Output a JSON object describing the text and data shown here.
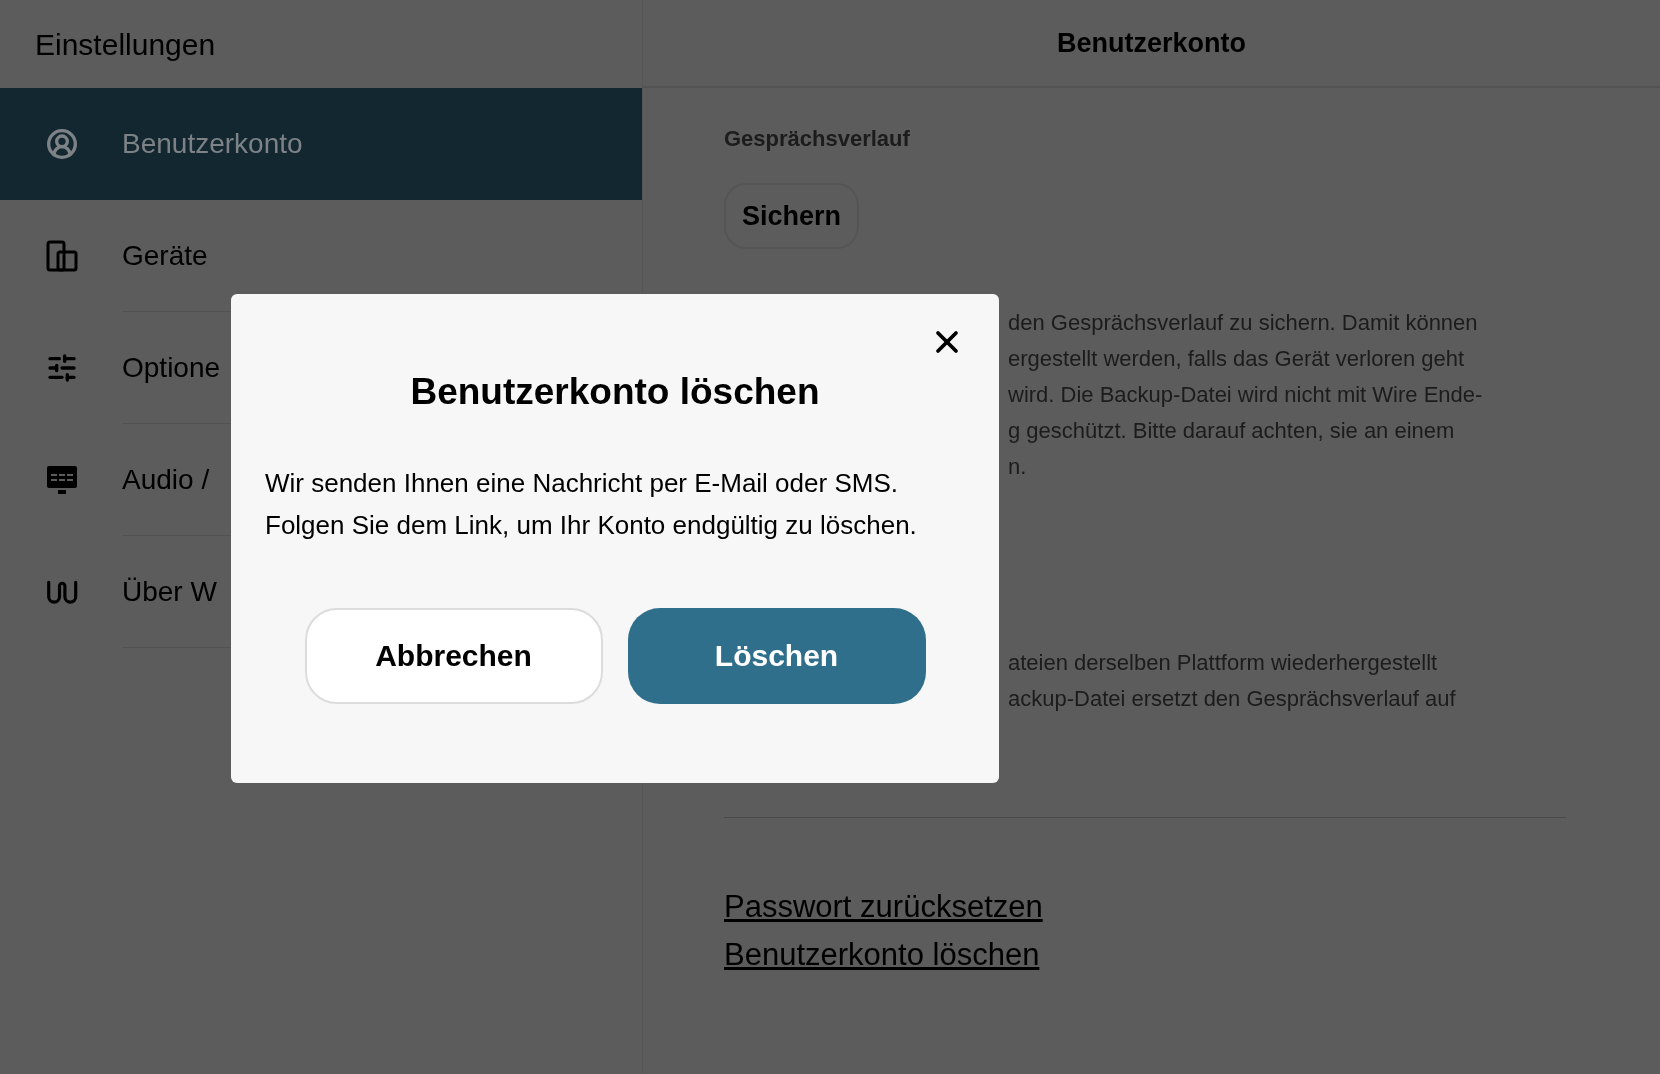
{
  "sidebar": {
    "title": "Einstellungen",
    "items": [
      {
        "kind": "account",
        "label": "Benutzerkonto",
        "selected": true
      },
      {
        "kind": "devices",
        "label": "Geräte",
        "selected": false
      },
      {
        "kind": "options",
        "label": "Optione",
        "selected": false
      },
      {
        "kind": "audio",
        "label": "Audio /",
        "selected": false
      },
      {
        "kind": "about",
        "label": "Über W",
        "selected": false
      }
    ]
  },
  "main": {
    "title": "Benutzerkonto",
    "section_title": "Gesprächsverlauf",
    "backup_button": "Sichern",
    "paragraph_1": [
      "den Gesprächsverlauf zu sichern. Damit können",
      "ergestellt werden, falls das Gerät verloren geht",
      "wird. Die Backup-Datei wird nicht mit Wire Ende-",
      "g geschützt. Bitte darauf achten, sie an einem",
      "n."
    ],
    "paragraph_2": [
      "ateien derselben Plattform wiederhergestellt",
      "ackup-Datei ersetzt den Gesprächsverlauf auf"
    ],
    "links": [
      "Passwort zurücksetzen",
      "Benutzerkonto löschen"
    ]
  },
  "dialog": {
    "title": "Benutzerkonto löschen",
    "body": "Wir senden Ihnen eine Nachricht per E-Mail oder SMS. Folgen Sie dem Link, um Ihr Konto endgültig zu löschen.",
    "buttons": [
      {
        "kind": "secondary",
        "label": "Abbrechen"
      },
      {
        "kind": "primary",
        "label": "Löschen"
      }
    ]
  }
}
